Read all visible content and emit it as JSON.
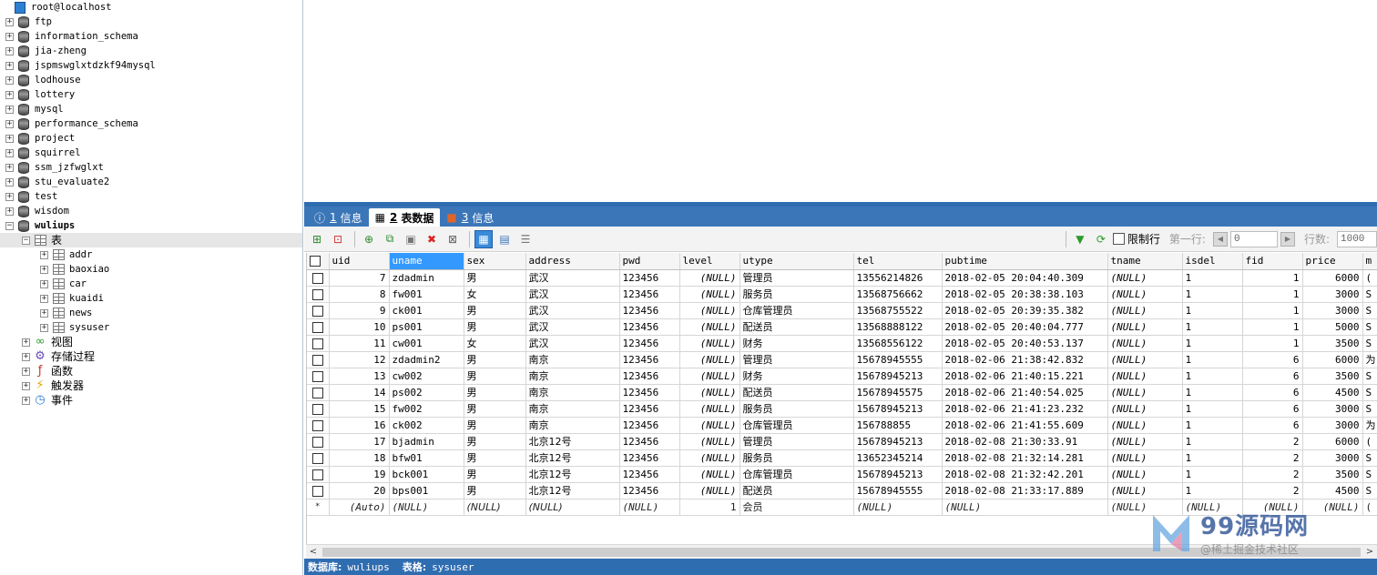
{
  "tree": {
    "root": "root@localhost",
    "databases": [
      "ftp",
      "information_schema",
      "jia-zheng",
      "jspmswglxtdzkf94mysql",
      "lodhouse",
      "lottery",
      "mysql",
      "performance_schema",
      "project",
      "squirrel",
      "ssm_jzfwglxt",
      "stu_evaluate2",
      "test",
      "wisdom"
    ],
    "active_db": {
      "name": "wuliups",
      "tables_folder": "表",
      "tables": [
        "addr",
        "baoxiao",
        "car",
        "kuaidi",
        "news",
        "sysuser"
      ],
      "folders": [
        {
          "label": "视图",
          "icon": "view-icon"
        },
        {
          "label": "存储过程",
          "icon": "gear-icon"
        },
        {
          "label": "函数",
          "icon": "function-icon"
        },
        {
          "label": "触发器",
          "icon": "lightning-icon"
        },
        {
          "label": "事件",
          "icon": "clock-icon"
        }
      ]
    }
  },
  "tabs": [
    {
      "num": "1",
      "label": "信息",
      "icon": "info-icon"
    },
    {
      "num": "2",
      "label": "表数据",
      "icon": "table-icon",
      "active": true
    },
    {
      "num": "3",
      "label": "信息",
      "icon": "info-icon"
    }
  ],
  "toolbar": {
    "limit_label": "限制行",
    "first_row_label": "第一行:",
    "first_row_value": "0",
    "rows_label": "行数:",
    "rows_value": "1000"
  },
  "grid": {
    "columns": [
      "uid",
      "uname",
      "sex",
      "address",
      "pwd",
      "level",
      "utype",
      "tel",
      "pubtime",
      "tname",
      "isdel",
      "fid",
      "price",
      "m"
    ],
    "selected_column": "uname",
    "rows": [
      [
        "7",
        "zdadmin",
        "男",
        "武汉",
        "123456",
        "(NULL)",
        "管理员",
        "13556214826",
        "2018-02-05 20:04:40.309",
        "(NULL)",
        "1",
        "1",
        "6000",
        "("
      ],
      [
        "8",
        "fw001",
        "女",
        "武汉",
        "123456",
        "(NULL)",
        "服务员",
        "13568756662",
        "2018-02-05 20:38:38.103",
        "(NULL)",
        "1",
        "1",
        "3000",
        "S"
      ],
      [
        "9",
        "ck001",
        "男",
        "武汉",
        "123456",
        "(NULL)",
        "仓库管理员",
        "13568755522",
        "2018-02-05 20:39:35.382",
        "(NULL)",
        "1",
        "1",
        "3000",
        "S"
      ],
      [
        "10",
        "ps001",
        "男",
        "武汉",
        "123456",
        "(NULL)",
        "配送员",
        "13568888122",
        "2018-02-05 20:40:04.777",
        "(NULL)",
        "1",
        "1",
        "5000",
        "S"
      ],
      [
        "11",
        "cw001",
        "女",
        "武汉",
        "123456",
        "(NULL)",
        "财务",
        "13568556122",
        "2018-02-05 20:40:53.137",
        "(NULL)",
        "1",
        "1",
        "3500",
        "S"
      ],
      [
        "12",
        "zdadmin2",
        "男",
        "南京",
        "123456",
        "(NULL)",
        "管理员",
        "15678945555",
        "2018-02-06 21:38:42.832",
        "(NULL)",
        "1",
        "6",
        "6000",
        "为"
      ],
      [
        "13",
        "cw002",
        "男",
        "南京",
        "123456",
        "(NULL)",
        "财务",
        "15678945213",
        "2018-02-06 21:40:15.221",
        "(NULL)",
        "1",
        "6",
        "3500",
        "S"
      ],
      [
        "14",
        "ps002",
        "男",
        "南京",
        "123456",
        "(NULL)",
        "配送员",
        "15678945575",
        "2018-02-06 21:40:54.025",
        "(NULL)",
        "1",
        "6",
        "4500",
        "S"
      ],
      [
        "15",
        "fw002",
        "男",
        "南京",
        "123456",
        "(NULL)",
        "服务员",
        "15678945213",
        "2018-02-06 21:41:23.232",
        "(NULL)",
        "1",
        "6",
        "3000",
        "S"
      ],
      [
        "16",
        "ck002",
        "男",
        "南京",
        "123456",
        "(NULL)",
        "仓库管理员",
        "156788855",
        "2018-02-06 21:41:55.609",
        "(NULL)",
        "1",
        "6",
        "3000",
        "为"
      ],
      [
        "17",
        "bjadmin",
        "男",
        "北京12号",
        "123456",
        "(NULL)",
        "管理员",
        "15678945213",
        "2018-02-08 21:30:33.91",
        "(NULL)",
        "1",
        "2",
        "6000",
        "("
      ],
      [
        "18",
        "bfw01",
        "男",
        "北京12号",
        "123456",
        "(NULL)",
        "服务员",
        "13652345214",
        "2018-02-08 21:32:14.281",
        "(NULL)",
        "1",
        "2",
        "3000",
        "S"
      ],
      [
        "19",
        "bck001",
        "男",
        "北京12号",
        "123456",
        "(NULL)",
        "仓库管理员",
        "15678945213",
        "2018-02-08 21:32:42.201",
        "(NULL)",
        "1",
        "2",
        "3500",
        "S"
      ],
      [
        "20",
        "bps001",
        "男",
        "北京12号",
        "123456",
        "(NULL)",
        "配送员",
        "15678945555",
        "2018-02-08 21:33:17.889",
        "(NULL)",
        "1",
        "2",
        "4500",
        "S"
      ]
    ],
    "new_row": [
      "(Auto)",
      "(NULL)",
      "(NULL)",
      "(NULL)",
      "(NULL)",
      "1",
      "会员",
      "(NULL)",
      "(NULL)",
      "(NULL)",
      "(NULL)",
      "(NULL)",
      "(NULL)",
      "("
    ],
    "new_row_marker": "*"
  },
  "status": {
    "db_label": "数据库:",
    "db_value": "wuliups",
    "table_label": "表格:",
    "table_value": "sysuser"
  },
  "watermark": {
    "title": "99源码网",
    "subtitle": "@稀土掘金技术社区"
  },
  "colors": {
    "accent_blue": "#2f6db1",
    "selected_header": "#3399ff"
  }
}
